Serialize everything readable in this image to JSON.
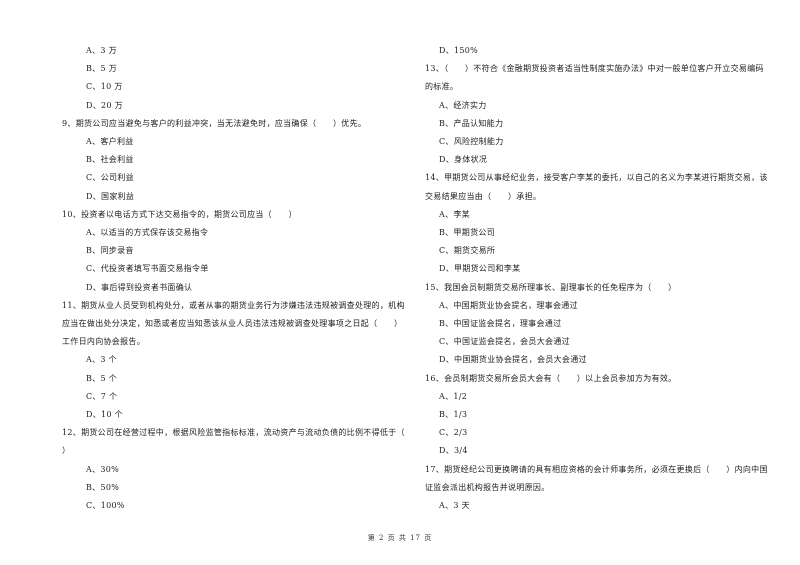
{
  "document": {
    "footer": "第 2 页 共 17 页",
    "left_column": [
      {
        "type": "option",
        "text": "A、3 万"
      },
      {
        "type": "option",
        "text": "B、5 万"
      },
      {
        "type": "option",
        "text": "C、10 万"
      },
      {
        "type": "option",
        "text": "D、20 万"
      },
      {
        "type": "question",
        "text": "9、期货公司应当避免与客户的利益冲突，当无法避免时，应当确保（　　）优先。"
      },
      {
        "type": "option",
        "text": "A、客户利益"
      },
      {
        "type": "option",
        "text": "B、社会利益"
      },
      {
        "type": "option",
        "text": "C、公司利益"
      },
      {
        "type": "option",
        "text": "D、国家利益"
      },
      {
        "type": "question",
        "text": "10、投资者以电话方式下达交易指令的，期货公司应当（　　）"
      },
      {
        "type": "option",
        "text": "A、以适当的方式保存该交易指令"
      },
      {
        "type": "option",
        "text": "B、同步录音"
      },
      {
        "type": "option",
        "text": "C、代投资者填写书面交易指令单"
      },
      {
        "type": "option",
        "text": "D、事后得到投资者书面确认"
      },
      {
        "type": "question",
        "text": "11、期货从业人员受到机构处分，或者从事的期货业务行为涉嫌违法违规被调查处理的，机构"
      },
      {
        "type": "question-cont",
        "text": "应当在做出处分决定，知悉或者应当知悉该从业人员违法违规被调查处理事项之日起（　　）"
      },
      {
        "type": "question-cont",
        "text": "工作日内向协会报告。"
      },
      {
        "type": "option",
        "text": "A、3 个"
      },
      {
        "type": "option",
        "text": "B、5 个"
      },
      {
        "type": "option",
        "text": "C、7 个"
      },
      {
        "type": "option",
        "text": "D、10 个"
      },
      {
        "type": "question",
        "text": "12、期货公司在经营过程中，根据风险监管指标标准，流动资产与流动负债的比例不得低于（"
      },
      {
        "type": "question-cont",
        "text": "）"
      },
      {
        "type": "option",
        "text": "A、30%"
      },
      {
        "type": "option",
        "text": "B、50%"
      },
      {
        "type": "option",
        "text": "C、100%"
      }
    ],
    "right_column": [
      {
        "type": "option",
        "text": "D、150%"
      },
      {
        "type": "question",
        "text": "13、（　　）不符合《金融期货投资者适当性制度实施办法》中对一般单位客户开立交易编码"
      },
      {
        "type": "question-cont",
        "text": "的标准。"
      },
      {
        "type": "option",
        "text": "A、经济实力"
      },
      {
        "type": "option",
        "text": "B、产品认知能力"
      },
      {
        "type": "option",
        "text": "C、风险控制能力"
      },
      {
        "type": "option",
        "text": "D、身体状况"
      },
      {
        "type": "question",
        "text": "14、甲期货公司从事经纪业务，接受客户李某的委托，以自己的名义为李某进行期货交易，该"
      },
      {
        "type": "question-cont",
        "text": "交易结果应当由（　　）承担。"
      },
      {
        "type": "option",
        "text": "A、李某"
      },
      {
        "type": "option",
        "text": "B、甲期货公司"
      },
      {
        "type": "option",
        "text": "C、期货交易所"
      },
      {
        "type": "option",
        "text": "D、甲期货公司和李某"
      },
      {
        "type": "question",
        "text": "15、我国会员制期货交易所理事长、副理事长的任免程序为（　　）"
      },
      {
        "type": "option",
        "text": "A、中国期货业协会提名，理事会通过"
      },
      {
        "type": "option",
        "text": "B、中国证监会提名，理事会通过"
      },
      {
        "type": "option",
        "text": "C、中国证监会提名，会员大会通过"
      },
      {
        "type": "option",
        "text": "D、中国期货业协会提名，会员大会通过"
      },
      {
        "type": "question",
        "text": "16、会员制期货交易所会员大会有（　　）以上会员参加方为有效。"
      },
      {
        "type": "option",
        "text": "A、1/2"
      },
      {
        "type": "option",
        "text": "B、1/3"
      },
      {
        "type": "option",
        "text": "C、2/3"
      },
      {
        "type": "option",
        "text": "D、3/4"
      },
      {
        "type": "question",
        "text": "17、期货经纪公司更换聘请的具有相应资格的会计师事务所，必须在更换后（　　）内向中国"
      },
      {
        "type": "question-cont",
        "text": "证监会派出机构报告并说明原因。"
      },
      {
        "type": "option",
        "text": "A、3 天"
      }
    ]
  }
}
